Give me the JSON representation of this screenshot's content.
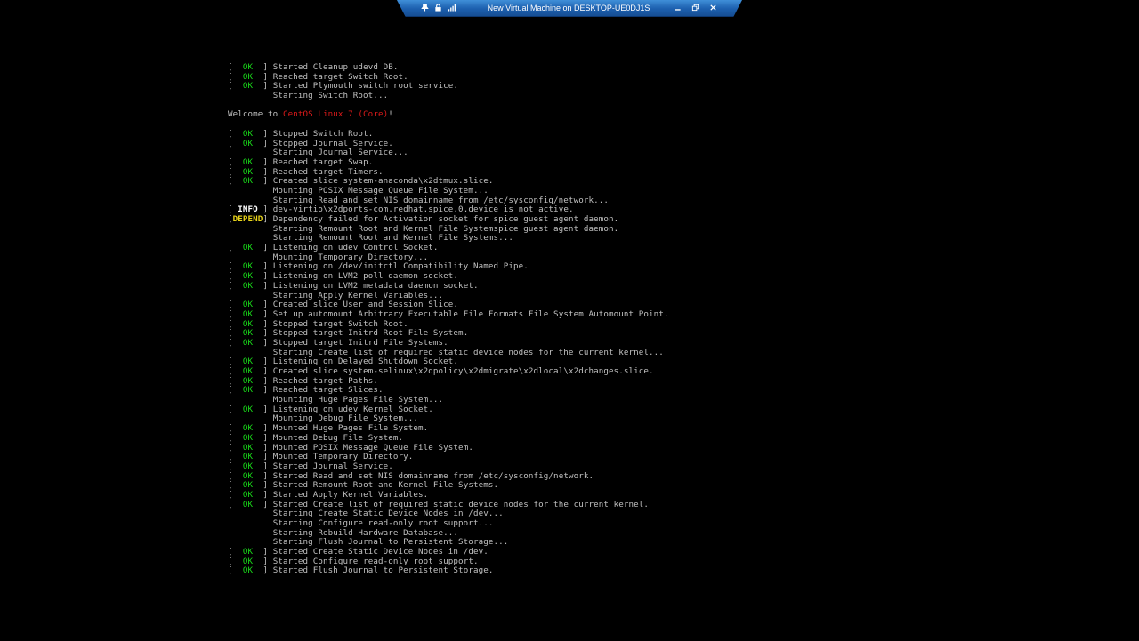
{
  "window": {
    "title": "New Virtual Machine on DESKTOP-UE0DJ1S"
  },
  "colors": {
    "background": "#000000",
    "text": "#c0c0c0",
    "ok": "#19d919",
    "depend": "#e8d41a",
    "highlight_red": "#dd1a1a",
    "bar": "#1c5fae"
  },
  "icons": {
    "left": [
      "pin-icon",
      "lock-icon",
      "signal-icon"
    ],
    "right": [
      "minimize-icon",
      "restore-icon",
      "close-icon"
    ]
  },
  "console": {
    "lines": [
      {
        "status": "OK",
        "text": "Started Cleanup udevd DB."
      },
      {
        "status": "OK",
        "text": "Reached target Switch Root."
      },
      {
        "status": "OK",
        "text": "Started Plymouth switch root service."
      },
      {
        "status": "",
        "text": "Starting Switch Root..."
      },
      {
        "type": "blank"
      },
      {
        "type": "welcome",
        "pre": "Welcome to ",
        "highlight": "CentOS Linux 7 (Core)",
        "post": "!"
      },
      {
        "type": "blank"
      },
      {
        "status": "OK",
        "text": "Stopped Switch Root."
      },
      {
        "status": "OK",
        "text": "Stopped Journal Service."
      },
      {
        "status": "",
        "text": "Starting Journal Service..."
      },
      {
        "status": "OK",
        "text": "Reached target Swap."
      },
      {
        "status": "OK",
        "text": "Reached target Timers."
      },
      {
        "status": "OK",
        "text": "Created slice system-anaconda\\x2dtmux.slice."
      },
      {
        "status": "",
        "text": "Mounting POSIX Message Queue File System..."
      },
      {
        "status": "",
        "text": "Starting Read and set NIS domainname from /etc/sysconfig/network..."
      },
      {
        "status": "INFO",
        "text": "dev-virtio\\x2dports-com.redhat.spice.0.device is not active."
      },
      {
        "status": "DEPEND",
        "text": "Dependency failed for Activation socket for spice guest agent daemon."
      },
      {
        "status": "",
        "text": "Starting Remount Root and Kernel File Systemspice guest agent daemon."
      },
      {
        "status": "",
        "text": "Starting Remount Root and Kernel File Systems..."
      },
      {
        "status": "OK",
        "text": "Listening on udev Control Socket."
      },
      {
        "status": "",
        "text": "Mounting Temporary Directory..."
      },
      {
        "status": "OK",
        "text": "Listening on /dev/initctl Compatibility Named Pipe."
      },
      {
        "status": "OK",
        "text": "Listening on LVM2 poll daemon socket."
      },
      {
        "status": "OK",
        "text": "Listening on LVM2 metadata daemon socket."
      },
      {
        "status": "",
        "text": "Starting Apply Kernel Variables..."
      },
      {
        "status": "OK",
        "text": "Created slice User and Session Slice."
      },
      {
        "status": "OK",
        "text": "Set up automount Arbitrary Executable File Formats File System Automount Point."
      },
      {
        "status": "OK",
        "text": "Stopped target Switch Root."
      },
      {
        "status": "OK",
        "text": "Stopped target Initrd Root File System."
      },
      {
        "status": "OK",
        "text": "Stopped target Initrd File Systems."
      },
      {
        "status": "",
        "text": "Starting Create list of required static device nodes for the current kernel..."
      },
      {
        "status": "OK",
        "text": "Listening on Delayed Shutdown Socket."
      },
      {
        "status": "OK",
        "text": "Created slice system-selinux\\x2dpolicy\\x2dmigrate\\x2dlocal\\x2dchanges.slice."
      },
      {
        "status": "OK",
        "text": "Reached target Paths."
      },
      {
        "status": "OK",
        "text": "Reached target Slices."
      },
      {
        "status": "",
        "text": "Mounting Huge Pages File System..."
      },
      {
        "status": "OK",
        "text": "Listening on udev Kernel Socket."
      },
      {
        "status": "",
        "text": "Mounting Debug File System..."
      },
      {
        "status": "OK",
        "text": "Mounted Huge Pages File System."
      },
      {
        "status": "OK",
        "text": "Mounted Debug File System."
      },
      {
        "status": "OK",
        "text": "Mounted POSIX Message Queue File System."
      },
      {
        "status": "OK",
        "text": "Mounted Temporary Directory."
      },
      {
        "status": "OK",
        "text": "Started Journal Service."
      },
      {
        "status": "OK",
        "text": "Started Read and set NIS domainname from /etc/sysconfig/network."
      },
      {
        "status": "OK",
        "text": "Started Remount Root and Kernel File Systems."
      },
      {
        "status": "OK",
        "text": "Started Apply Kernel Variables."
      },
      {
        "status": "OK",
        "text": "Started Create list of required static device nodes for the current kernel."
      },
      {
        "status": "",
        "text": "Starting Create Static Device Nodes in /dev..."
      },
      {
        "status": "",
        "text": "Starting Configure read-only root support..."
      },
      {
        "status": "",
        "text": "Starting Rebuild Hardware Database..."
      },
      {
        "status": "",
        "text": "Starting Flush Journal to Persistent Storage..."
      },
      {
        "status": "OK",
        "text": "Started Create Static Device Nodes in /dev."
      },
      {
        "status": "OK",
        "text": "Started Configure read-only root support."
      },
      {
        "status": "OK",
        "text": "Started Flush Journal to Persistent Storage."
      }
    ]
  }
}
